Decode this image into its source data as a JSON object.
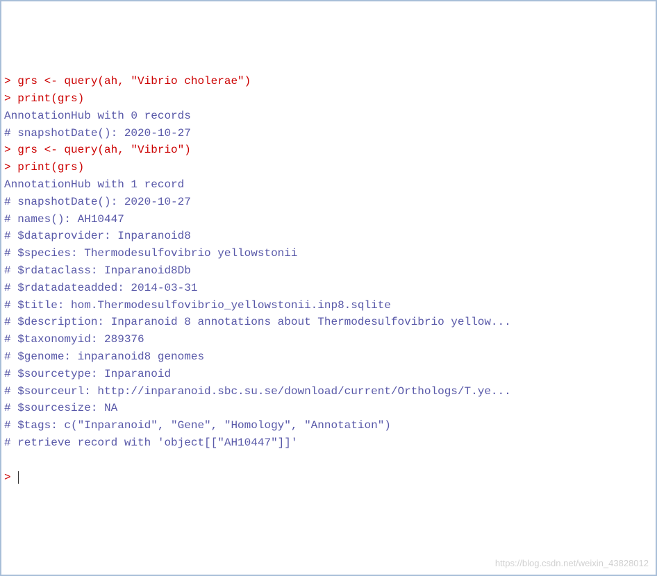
{
  "lines": [
    {
      "type": "input",
      "text": "> grs <- query(ah, \"Vibrio cholerae\")"
    },
    {
      "type": "input",
      "text": "> print(grs)"
    },
    {
      "type": "output",
      "text": "AnnotationHub with 0 records"
    },
    {
      "type": "output",
      "text": "# snapshotDate(): 2020-10-27"
    },
    {
      "type": "input",
      "text": "> grs <- query(ah, \"Vibrio\")"
    },
    {
      "type": "input",
      "text": "> print(grs)"
    },
    {
      "type": "output",
      "text": "AnnotationHub with 1 record"
    },
    {
      "type": "output",
      "text": "# snapshotDate(): 2020-10-27"
    },
    {
      "type": "output",
      "text": "# names(): AH10447"
    },
    {
      "type": "output",
      "text": "# $dataprovider: Inparanoid8"
    },
    {
      "type": "output",
      "text": "# $species: Thermodesulfovibrio yellowstonii"
    },
    {
      "type": "output",
      "text": "# $rdataclass: Inparanoid8Db"
    },
    {
      "type": "output",
      "text": "# $rdatadateadded: 2014-03-31"
    },
    {
      "type": "output",
      "text": "# $title: hom.Thermodesulfovibrio_yellowstonii.inp8.sqlite"
    },
    {
      "type": "output",
      "text": "# $description: Inparanoid 8 annotations about Thermodesulfovibrio yellow..."
    },
    {
      "type": "output",
      "text": "# $taxonomyid: 289376"
    },
    {
      "type": "output",
      "text": "# $genome: inparanoid8 genomes"
    },
    {
      "type": "output",
      "text": "# $sourcetype: Inparanoid"
    },
    {
      "type": "output",
      "text": "# $sourceurl: http://inparanoid.sbc.su.se/download/current/Orthologs/T.ye..."
    },
    {
      "type": "output",
      "text": "# $sourcesize: NA"
    },
    {
      "type": "output",
      "text": "# $tags: c(\"Inparanoid\", \"Gene\", \"Homology\", \"Annotation\")"
    },
    {
      "type": "output",
      "text": "# retrieve record with 'object[[\"AH10447\"]]'"
    }
  ],
  "prompt": "> ",
  "watermark": "https://blog.csdn.net/weixin_43828012"
}
